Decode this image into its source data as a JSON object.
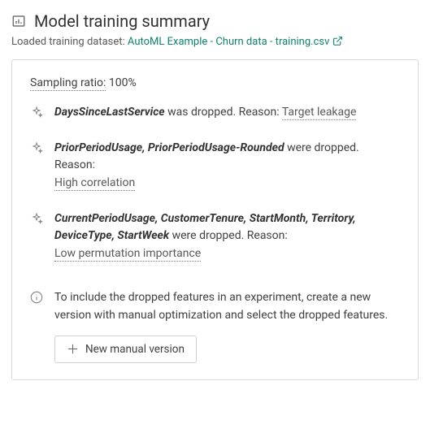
{
  "header": {
    "title": "Model training summary",
    "loaded_label": "Loaded training dataset:",
    "dataset_link": "AutoML Example - Churn data - training.csv"
  },
  "sampling": {
    "label": "Sampling ratio:",
    "value": "100%"
  },
  "drops": [
    {
      "features": "DaysSinceLastService",
      "plural": false,
      "reason": "Target leakage"
    },
    {
      "features": "PriorPeriodUsage, PriorPeriodUsage-Rounded",
      "plural": true,
      "reason": "High correlation"
    },
    {
      "features": "CurrentPeriodUsage, CustomerTenure, StartMonth, Territory, DeviceType, StartWeek",
      "plural": true,
      "reason": "Low permutation importance"
    }
  ],
  "strings": {
    "was_dropped": " was dropped. Reason: ",
    "were_dropped": " were dropped. Reason:"
  },
  "info": {
    "text": "To include the dropped features in an experiment, create a new version with manual optimization and select the dropped features.",
    "button": "New manual version"
  }
}
